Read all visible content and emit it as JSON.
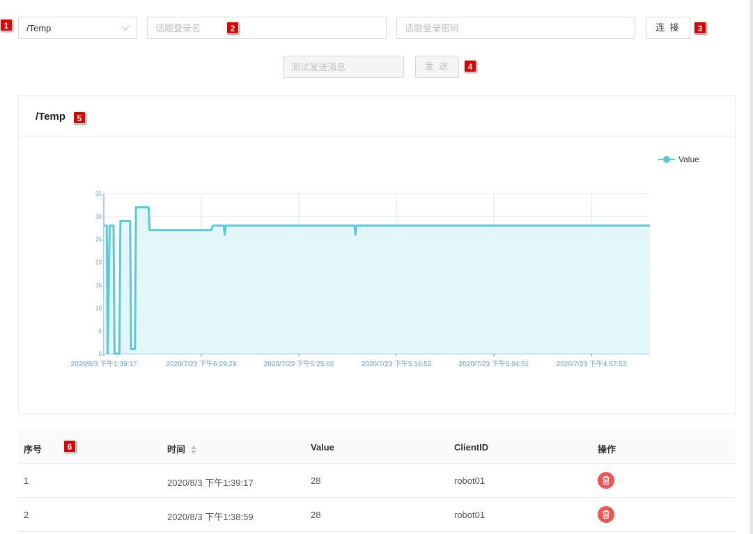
{
  "toolbar": {
    "topic_select": {
      "value": "/Temp"
    },
    "username_placeholder": "话题登录名",
    "password_placeholder": "话题登录密码",
    "connect_label": "连 接",
    "test_message_placeholder": "测试发送消息",
    "send_label": "发 送"
  },
  "badges": [
    "1",
    "2",
    "3",
    "4",
    "5",
    "6"
  ],
  "card": {
    "title": "/Temp"
  },
  "chart_data": {
    "type": "area",
    "legend": {
      "entries": [
        "Value"
      ],
      "position": "top-right"
    },
    "series": [
      {
        "name": "Value",
        "color": "#5bc8d8",
        "fill": "#e0f5f8",
        "points": [
          [
            0,
            28
          ],
          [
            0.3,
            28
          ],
          [
            0.4,
            0
          ],
          [
            0.6,
            28
          ],
          [
            1.0,
            28
          ],
          [
            1.1,
            0
          ],
          [
            1.6,
            0
          ],
          [
            1.7,
            29
          ],
          [
            2.7,
            29
          ],
          [
            2.8,
            1
          ],
          [
            3.2,
            1
          ],
          [
            3.3,
            32
          ],
          [
            4.6,
            32
          ],
          [
            4.7,
            27
          ],
          [
            11.0,
            27
          ],
          [
            11.2,
            28
          ],
          [
            12.3,
            28
          ],
          [
            12.4,
            26
          ],
          [
            12.5,
            28
          ],
          [
            25.7,
            28
          ],
          [
            25.8,
            26
          ],
          [
            25.9,
            28
          ],
          [
            56.0,
            28
          ]
        ]
      }
    ],
    "x_ticks": [
      "2020/8/3 下午1:39:17",
      "2020/7/23 下午6:29:29",
      "2020/7/23 下午5:25:02",
      "2020/7/23 下午5:16:52",
      "2020/7/23 下午5:04:51",
      "2020/7/23 下午4:57:53"
    ],
    "x_tick_positions": [
      0,
      10,
      20,
      30,
      40,
      50
    ],
    "xlim": [
      0,
      56
    ],
    "y_ticks": [
      "0",
      "5",
      "10",
      "15",
      "20",
      "25",
      "30",
      "35"
    ],
    "ylim": [
      0,
      35
    ],
    "grid": true,
    "axis_color": "#5b9bd5"
  },
  "table": {
    "columns": [
      "序号",
      "时间",
      "Value",
      "ClientID",
      "操作"
    ],
    "rows": [
      {
        "index": "1",
        "time": "2020/8/3 下午1:39:17",
        "value": "28",
        "client": "robot01"
      },
      {
        "index": "2",
        "time": "2020/8/3 下午1:38:59",
        "value": "28",
        "client": "robot01"
      }
    ]
  },
  "colors": {
    "accent": "#5bc8d8",
    "danger": "#f25353",
    "badge": "#e00000"
  }
}
